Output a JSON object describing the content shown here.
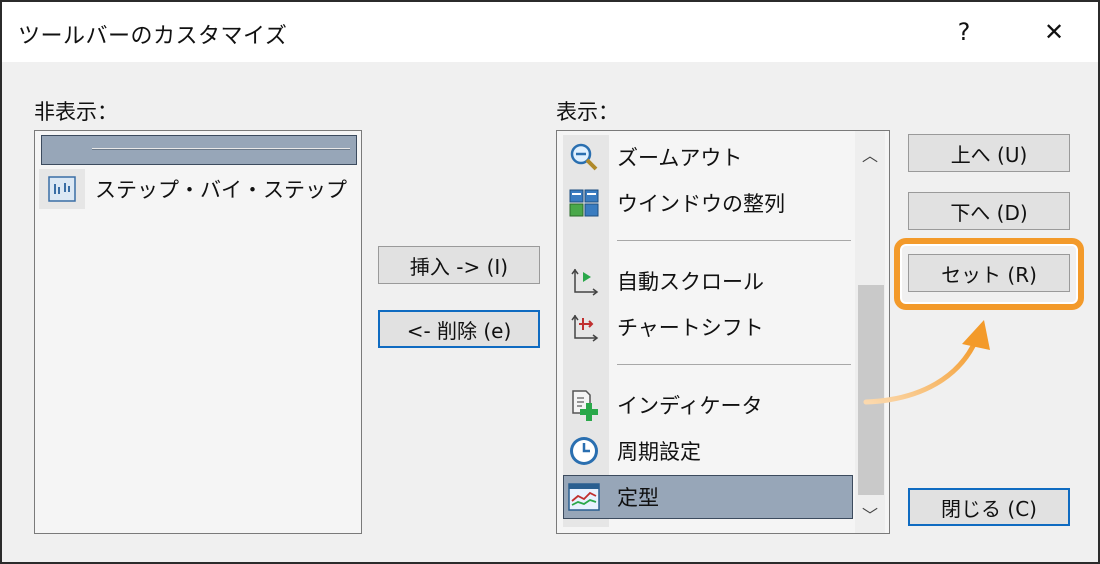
{
  "window": {
    "title": "ツールバーのカスタマイズ",
    "help": "?",
    "close": "✕"
  },
  "hidden_panel": {
    "label": "非表示：",
    "items": [
      {
        "type": "separator",
        "selected": true
      },
      {
        "type": "item",
        "label": "ステップ・バイ・ステップ",
        "icon": "step-by-step-icon"
      }
    ]
  },
  "shown_panel": {
    "label": "表示：",
    "items": [
      {
        "type": "item",
        "label": "ズームアウト",
        "icon": "zoom-out-icon"
      },
      {
        "type": "item",
        "label": "ウインドウの整列",
        "icon": "tile-windows-icon"
      },
      {
        "type": "separator"
      },
      {
        "type": "item",
        "label": "自動スクロール",
        "icon": "auto-scroll-icon"
      },
      {
        "type": "item",
        "label": "チャートシフト",
        "icon": "chart-shift-icon"
      },
      {
        "type": "separator"
      },
      {
        "type": "item",
        "label": "インディケータ",
        "icon": "indicator-add-icon"
      },
      {
        "type": "item",
        "label": "周期設定",
        "icon": "period-clock-icon"
      },
      {
        "type": "item",
        "label": "定型",
        "icon": "template-icon",
        "selected": true
      }
    ]
  },
  "buttons": {
    "insert": "挿入 -> (I)",
    "delete": "<- 削除 (e)",
    "up": "上へ (U)",
    "down": "下へ (D)",
    "set": "セット (R)",
    "close": "閉じる (C)"
  },
  "colors": {
    "highlight": "#f39a2a",
    "selection": "#97a6b8",
    "focus_border": "#0f6bc1"
  }
}
